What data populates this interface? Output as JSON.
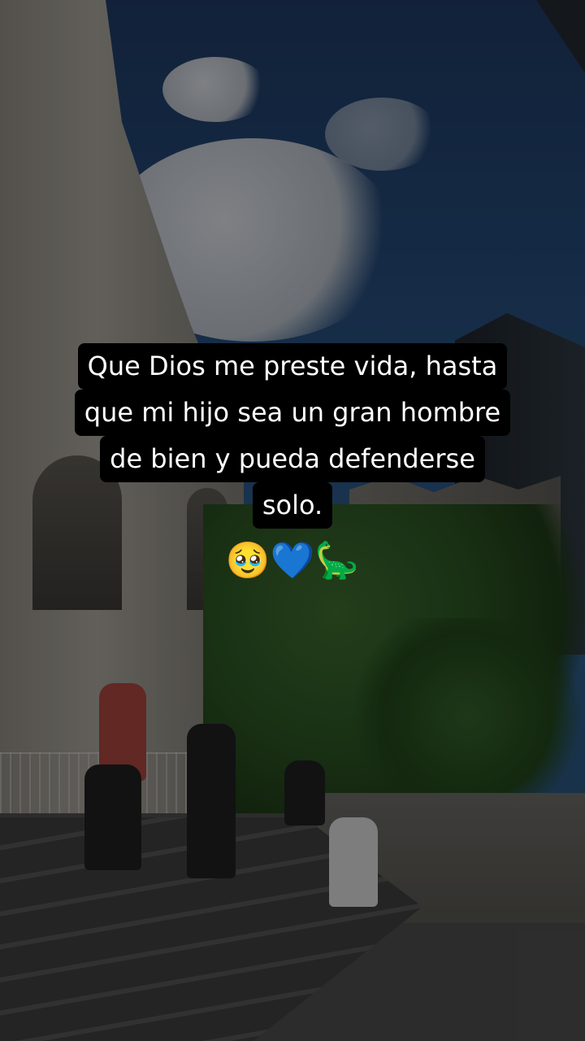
{
  "caption": {
    "lines": [
      "Que Dios me preste vida, hasta",
      "que mi hijo sea un gran hombre",
      "de bien y pueda defenderse",
      "solo."
    ],
    "emojis": "🥹💙🦕"
  }
}
